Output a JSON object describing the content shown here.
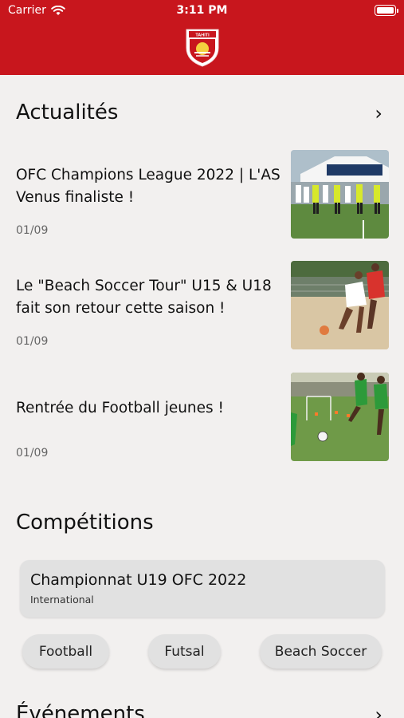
{
  "status_bar": {
    "carrier": "Carrier",
    "time": "3:11 PM"
  },
  "header": {
    "brand_color": "#c8161d",
    "logo_text": "TAHITI"
  },
  "news": {
    "title": "Actualités",
    "items": [
      {
        "title": "OFC Champions League 2022 | L'AS Venus finaliste !",
        "date": "01/09"
      },
      {
        "title": "Le \"Beach Soccer Tour\" U15 & U18 fait son retour cette saison !",
        "date": "01/09"
      },
      {
        "title": "Rentrée du Football jeunes !",
        "date": "01/09"
      }
    ]
  },
  "competitions": {
    "title": "Compétitions",
    "card": {
      "name": "Championnat U19 OFC 2022",
      "category": "International"
    },
    "filters": [
      "Football",
      "Futsal",
      "Beach Soccer"
    ]
  },
  "events": {
    "title": "Événements"
  }
}
